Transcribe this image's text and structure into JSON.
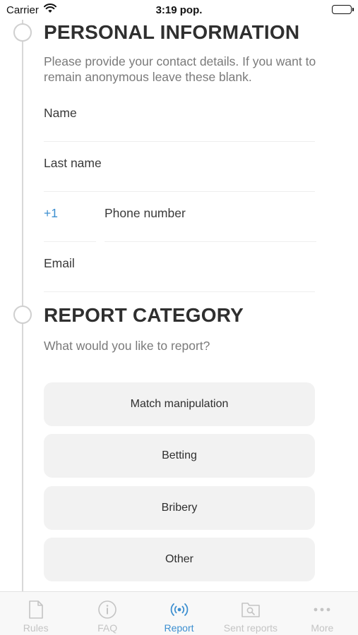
{
  "status_bar": {
    "carrier": "Carrier",
    "time": "3:19 pop."
  },
  "personal": {
    "title": "PERSONAL INFORMATION",
    "description": "Please provide your contact details. If you want to remain anonymous leave these blank.",
    "fields": {
      "name": "Name",
      "last_name": "Last name",
      "phone_code": "+1",
      "phone_number": "Phone number",
      "email": "Email"
    }
  },
  "report_category": {
    "title": "REPORT CATEGORY",
    "description": "What would you like to report?",
    "options": [
      "Match manipulation",
      "Betting",
      "Bribery",
      "Other"
    ]
  },
  "tabs": [
    {
      "label": "Rules",
      "icon": "document-icon",
      "active": false
    },
    {
      "label": "FAQ",
      "icon": "info-icon",
      "active": false
    },
    {
      "label": "Report",
      "icon": "broadcast-icon",
      "active": true
    },
    {
      "label": "Sent reports",
      "icon": "search-folder-icon",
      "active": false
    },
    {
      "label": "More",
      "icon": "more-icon",
      "active": false
    }
  ],
  "colors": {
    "accent": "#3d8fd0",
    "inactive": "#c4c4c4",
    "button_bg": "#f2f2f2"
  }
}
